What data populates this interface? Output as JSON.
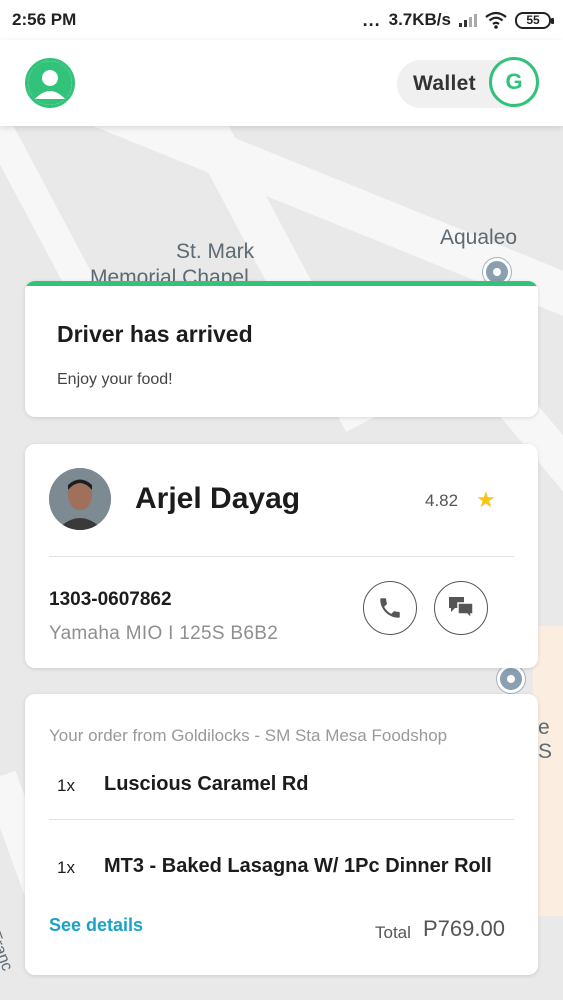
{
  "status_bar": {
    "time": "2:56 PM",
    "dots": "...",
    "network_speed": "3.7KB/s",
    "battery": "55"
  },
  "header": {
    "wallet_label": "Wallet",
    "wallet_icon_letter": "G",
    "accent_color": "#33c27a"
  },
  "map": {
    "labels": {
      "chapel_line1": "St. Mark",
      "chapel_line2": "Memorial Chapel",
      "aqualeo": "Aqualeo",
      "right_edge": "e S",
      "street": "M. Franc"
    }
  },
  "status_card": {
    "title": "Driver has arrived",
    "subtitle": "Enjoy your food!"
  },
  "driver": {
    "name": "Arjel Dayag",
    "rating": "4.82",
    "plate": "1303-0607862",
    "vehicle": "Yamaha   MIO I 125S B6B2"
  },
  "order": {
    "from": "Your order from Goldilocks - SM Sta Mesa Foodshop",
    "items": [
      {
        "qty": "1x",
        "name": "Luscious Caramel Rd"
      },
      {
        "qty": "1x",
        "name": "MT3 - Baked Lasagna W/ 1Pc Dinner Roll"
      }
    ],
    "see_details": "See details",
    "total_label": "Total",
    "total_value": "P769.00"
  }
}
